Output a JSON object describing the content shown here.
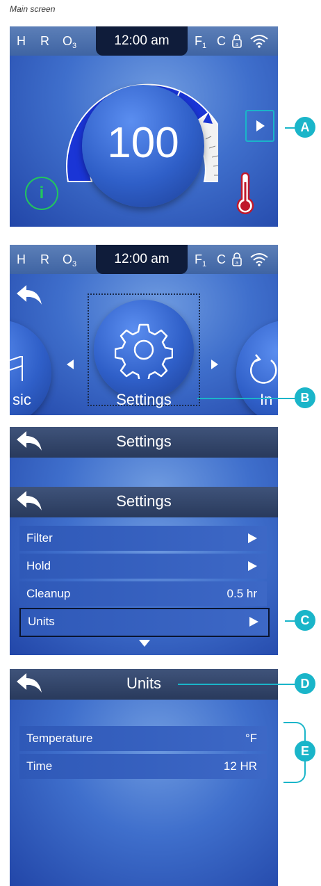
{
  "caption": "Main screen",
  "status": {
    "h": "H",
    "r": "R",
    "o": "O",
    "o_sub": "3",
    "time": "12:00 am",
    "f": "F",
    "f_sub": "1",
    "c": "C"
  },
  "main": {
    "temperature": "100"
  },
  "menu": {
    "left_label": "sic",
    "center_label": "Settings",
    "right_label": "In"
  },
  "settings": {
    "title": "Settings",
    "rows": [
      {
        "label": "Filter",
        "value": ""
      },
      {
        "label": "Hold",
        "value": ""
      },
      {
        "label": "Cleanup",
        "value": "0.5 hr"
      },
      {
        "label": "Units",
        "value": ""
      }
    ]
  },
  "units": {
    "title": "Units",
    "rows": [
      {
        "label": "Temperature",
        "value": "°F"
      },
      {
        "label": "Time",
        "value": "12 HR"
      }
    ]
  },
  "callouts": {
    "a": "A",
    "b": "B",
    "c": "C",
    "d": "D",
    "e": "E"
  },
  "colors": {
    "callout": "#1ab5c9",
    "info": "#22c55e",
    "thermo": "#c0182b",
    "dial_fill": "#1a35d6"
  },
  "icons": [
    "info-icon",
    "thermometer-icon",
    "lock-icon",
    "wifi-icon",
    "back-arrow-icon",
    "gear-icon",
    "refresh-icon",
    "triangle-right-icon",
    "triangle-left-icon",
    "triangle-down-icon"
  ]
}
